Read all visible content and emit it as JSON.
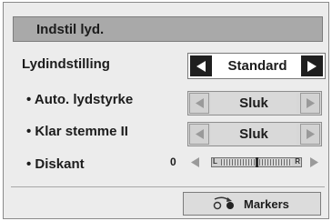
{
  "window": {
    "title": "Indstil lyd."
  },
  "sound_mode": {
    "label": "Lydindstilling",
    "value": "Standard"
  },
  "settings": [
    {
      "label": "• Auto. lydstyrke",
      "value": "Sluk"
    },
    {
      "label": "• Klar stemme II",
      "value": "Sluk"
    }
  ],
  "treble": {
    "label": "• Diskant",
    "value": "0",
    "left_end": "L",
    "right_end": "R",
    "position": 0.5
  },
  "footer": {
    "markers_label": "Markers"
  },
  "colors": {
    "panel": "#ececec",
    "titlebar": "#a9a9a9",
    "selected_arrow": "#1f1f1f"
  }
}
